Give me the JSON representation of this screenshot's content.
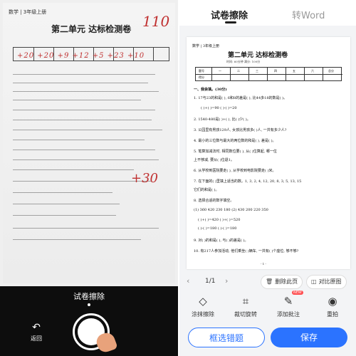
{
  "left_panel": {
    "photo": {
      "header": "数学 | 3年级上册",
      "title": "第二单元  达标检测卷",
      "scores_handwritten": "+20 +20 +9 +12 +5 +23 +10",
      "total_handwritten": "110",
      "extra_handwritten": "+30"
    },
    "caption": "试卷擦除",
    "back_label": "返回"
  },
  "right_panel": {
    "tabs": [
      {
        "label": "试卷擦除",
        "active": true
      },
      {
        "label": "转Word",
        "active": false
      }
    ],
    "doc": {
      "header": "数学 | 3年级上册",
      "title": "第二单元  达标检测卷",
      "subtitle": "时间: 60分钟  满分: 100分",
      "table_row1": [
        "题号",
        "一",
        "二",
        "三",
        "四",
        "五",
        "六",
        "总分"
      ],
      "table_row2": [
        "得分"
      ],
      "section": "一、我会填。(30分)",
      "questions": [
        "1. 17与23的和是(      ), 6和8的差是(      ), 比44多18的数是(      )。",
        "(      )+(      )=90      (      )-(      )=20",
        "2. 1540-480是(      )+(      ), 比(      )少(      )。",
        "3. 公园里有男孩129人, 女孩比男孩多(      )人, 一共有多少人?",
        "4. 最小的三位数与最大的两位数的和是(      ), 差是(      )。",
        "5. 笔算加减法时, 相同数位要(      ), 从(      )位算起, 哪一位",
        "   上不够减, 要从(      )位退1。",
        "6. 从学校到医院要走(      ), 从学校到电影院要走(      )米。",
        "7. 在下面的(      )里填上适当的数。1, 3, 2, 4, 12, 20, 8, 3, 5, 13, 15",
        "   它们的和是(      )。",
        "8. 选择合适的数字填空。",
        "(1) 360  420  230  180        (2) 430  200  220  350",
        "(      )+(      )=420           (      )+(      )=520",
        "(      )-(      )=180           (      )-(      )=180",
        "9. 对(      )的和是(      ), 与(      )的差是(      )。",
        "10. 有217人参加活动, 他们乘坐(      )辆车, 一共有(      )个座位, 够不够?"
      ],
      "page_number": "- 1 -"
    },
    "pager": {
      "count": "1/1",
      "delete_label": "删除此页",
      "compare_label": "对比原图"
    },
    "tools": [
      {
        "label": "涂抹擦除",
        "icon": "eraser-icon"
      },
      {
        "label": "裁切旋转",
        "icon": "crop-icon"
      },
      {
        "label": "添加批注",
        "icon": "annotate-icon",
        "badge": "NEW"
      },
      {
        "label": "重拍",
        "icon": "camera-icon"
      }
    ],
    "buttons": {
      "secondary": "框选错题",
      "primary": "保存"
    }
  },
  "colors": {
    "accent": "#2b73ff",
    "badge": "#ff4d4f",
    "ink": "#c03030"
  }
}
